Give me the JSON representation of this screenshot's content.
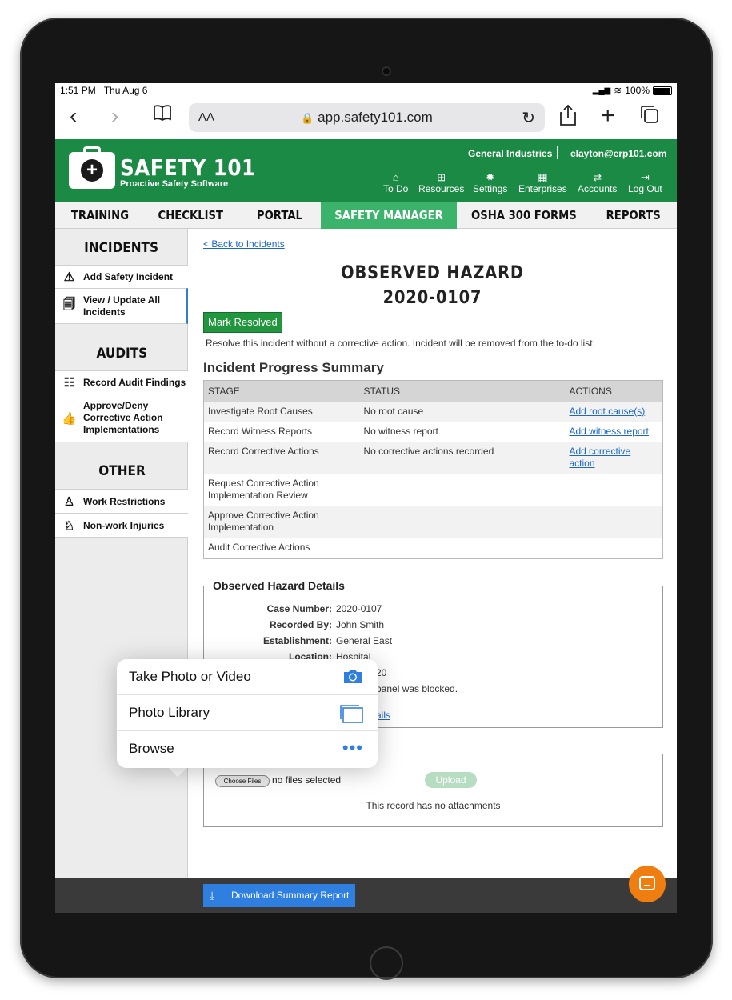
{
  "status": {
    "time": "1:51 PM",
    "date": "Thu Aug 6",
    "battery": "100%"
  },
  "browser": {
    "text_size": "AA",
    "url": "app.safety101.com"
  },
  "header": {
    "brand": "SAFETY 101",
    "tagline": "Proactive Safety Software",
    "company": "General Industries",
    "email": "clayton@erp101.com",
    "nav": [
      {
        "label": "To Do"
      },
      {
        "label": "Resources"
      },
      {
        "label": "Settings"
      },
      {
        "label": "Enterprises"
      },
      {
        "label": "Accounts"
      },
      {
        "label": "Log Out"
      }
    ]
  },
  "tabs": [
    {
      "label": "TRAINING"
    },
    {
      "label": "CHECKLIST"
    },
    {
      "label": "PORTAL"
    },
    {
      "label": "SAFETY MANAGER"
    },
    {
      "label": "OSHA 300 FORMS"
    },
    {
      "label": "REPORTS"
    }
  ],
  "sidebar": {
    "incidents_title": "INCIDENTS",
    "incidents": [
      {
        "label": "Add Safety Incident"
      },
      {
        "label": "View / Update All Incidents"
      }
    ],
    "audits_title": "AUDITS",
    "audits": [
      {
        "label": "Record Audit Findings"
      },
      {
        "label": "Approve/Deny Corrective Action Implementations"
      }
    ],
    "other_title": "OTHER",
    "other": [
      {
        "label": "Work Restrictions"
      },
      {
        "label": "Non-work Injuries"
      }
    ]
  },
  "content": {
    "back_link": "< Back to Incidents",
    "title_line1": "OBSERVED HAZARD",
    "title_line2": "2020-0107",
    "mark_resolved": "Mark Resolved",
    "resolve_note": "Resolve this incident without a corrective action. Incident will be removed from the to-do list.",
    "progress_title": "Incident Progress Summary",
    "progress_headers": [
      "STAGE",
      "STATUS",
      "ACTIONS"
    ],
    "progress_rows": [
      {
        "stage": "Investigate Root Causes",
        "status": "No root cause",
        "action": "Add root cause(s)"
      },
      {
        "stage": "Record Witness Reports",
        "status": "No witness report",
        "action": "Add witness report"
      },
      {
        "stage": "Record Corrective Actions",
        "status": "No corrective actions recorded",
        "action": "Add corrective action"
      },
      {
        "stage": "Request Corrective Action Implementation Review",
        "status": "",
        "action": ""
      },
      {
        "stage": "Approve Corrective Action Implementation",
        "status": "",
        "action": ""
      },
      {
        "stage": "Audit Corrective Actions",
        "status": "",
        "action": ""
      }
    ],
    "details_title": "Observed Hazard Details",
    "details": [
      {
        "key": "Case Number:",
        "value": "2020-0107"
      },
      {
        "key": "Recorded By:",
        "value": "John Smith"
      },
      {
        "key": "Establishment:",
        "value": "General East"
      },
      {
        "key": "Location:",
        "value": "Hospital"
      },
      {
        "key": "",
        "value": "20"
      },
      {
        "key": "",
        "value": "panel was blocked."
      },
      {
        "key": "",
        "value": "ails"
      }
    ],
    "choose_files": "Choose Files",
    "no_files": "no files selected",
    "upload": "Upload",
    "no_attachments": "This record has no attachments"
  },
  "footer": {
    "download": "Download Summary Report"
  },
  "popover": [
    {
      "label": "Take Photo or Video",
      "icon": "camera-icon"
    },
    {
      "label": "Photo Library",
      "icon": "photo-library-icon"
    },
    {
      "label": "Browse",
      "icon": "more-icon"
    }
  ]
}
